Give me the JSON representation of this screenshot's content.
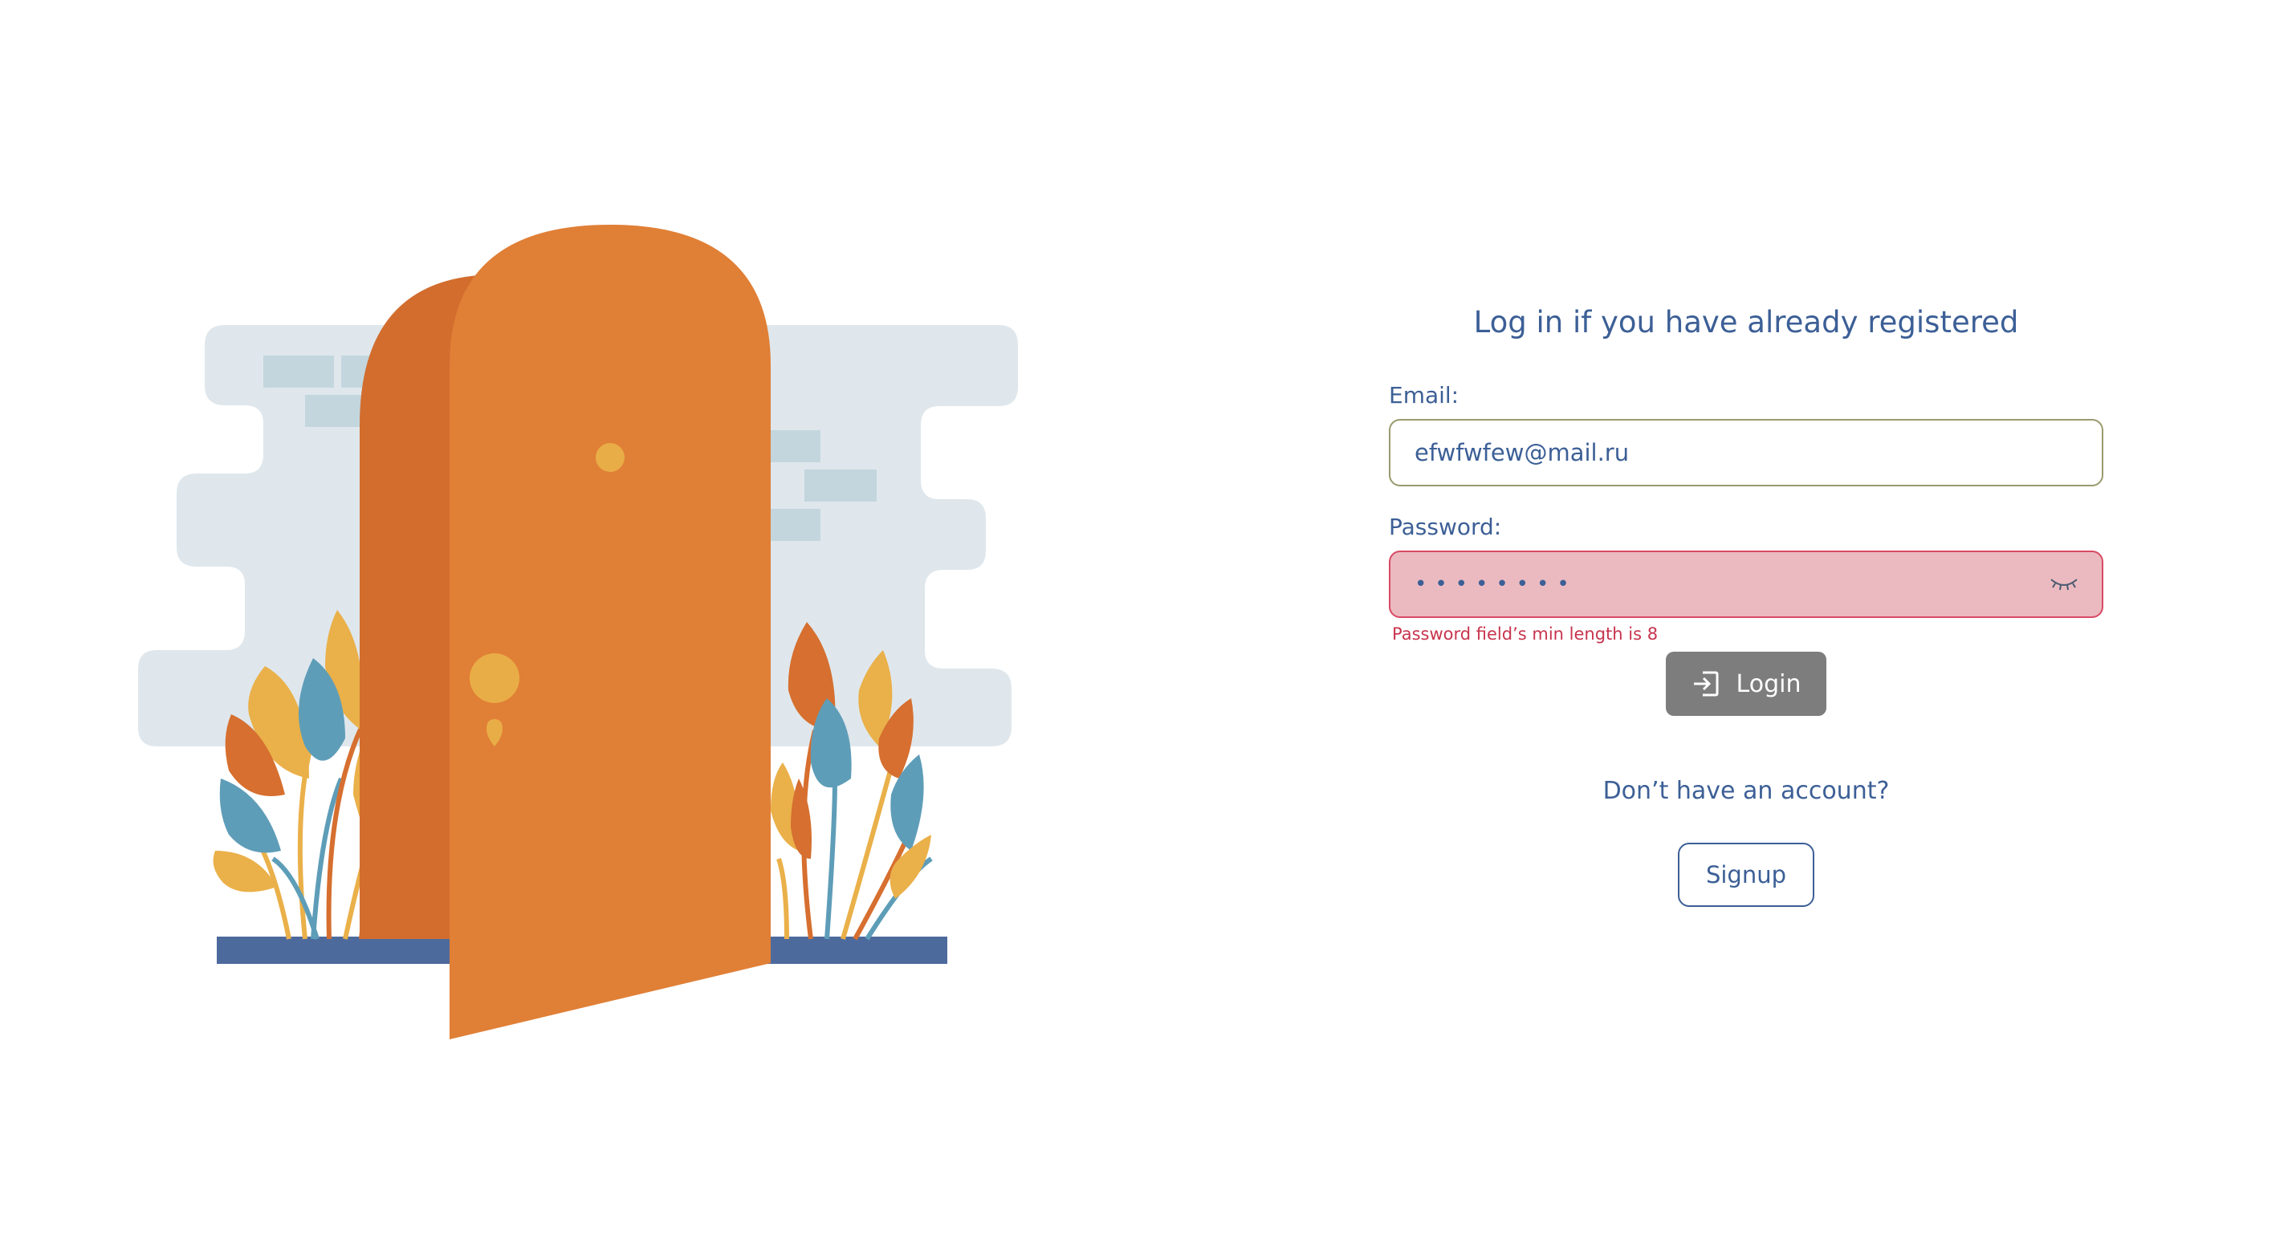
{
  "form": {
    "title": "Log in if you have already registered",
    "email_label": "Email:",
    "email_value": "efwfwfew@mail.ru",
    "password_label": "Password:",
    "password_value": "12345678",
    "password_error": "Password field’s min length is 8",
    "login_label": "Login",
    "no_account_text": "Don’t have an account?",
    "signup_label": "Signup"
  },
  "icons": {
    "eye_toggle": "eye-closed-icon",
    "login": "login-arrow-icon"
  },
  "colors": {
    "door": "#e07f36",
    "door_shadow": "#d26d2e",
    "knob": "#e9ad47",
    "wall": "#dfe7ec",
    "brick": "#c3d6dd",
    "floor": "#4d6a9d",
    "leaf_yellow": "#eab049",
    "leaf_orange": "#d66f2f",
    "leaf_blue": "#5e9db8",
    "text_primary": "#3c5f96",
    "error": "#c8344e",
    "error_bg": "#ebbac0",
    "login_button_bg": "#7d7d7d"
  }
}
